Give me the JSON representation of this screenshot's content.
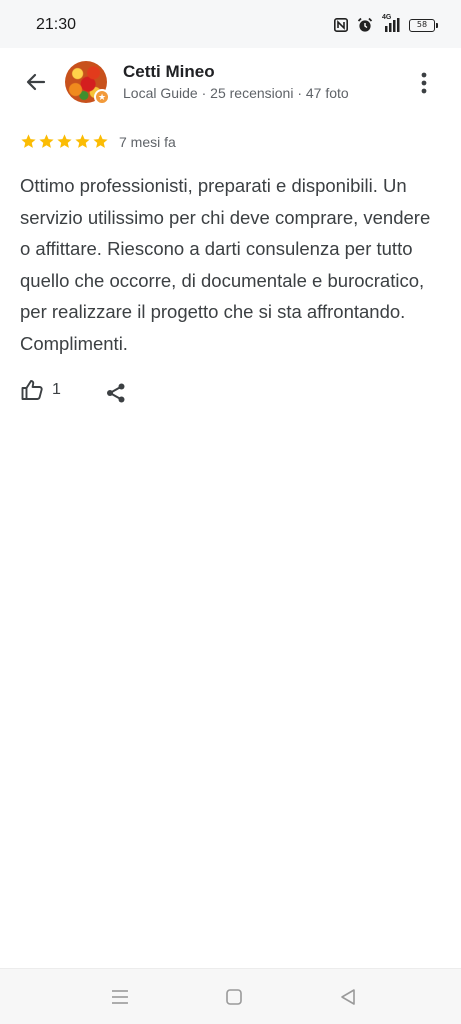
{
  "status_bar": {
    "time": "21:30",
    "network": "4G",
    "battery": "58",
    "icons": [
      "nfc-icon",
      "alarm-icon",
      "signal-icon",
      "battery-icon"
    ]
  },
  "header": {
    "back_icon": "arrow-left-icon",
    "name": "Cetti Mineo",
    "meta": "Local Guide · 25 recensioni · 47 foto",
    "more_icon": "more-vert-icon"
  },
  "review": {
    "stars": 5,
    "max_stars": 5,
    "star_color": "#fbbc04",
    "date": "7 mesi fa",
    "text": "Ottimo professionisti, preparati e disponibili. Un servizio utilissimo per chi deve comprare, vendere o affittare. Riescono a darti consulenza per tutto quello che occorre, di documentale e burocratico, per realizzare il progetto che si sta affrontando. Complimenti."
  },
  "actions": {
    "like_icon": "thumb-up-icon",
    "like_count": "1",
    "share_icon": "share-icon"
  },
  "nav": {
    "icons": [
      "menu-icon",
      "home-icon",
      "back-triangle-icon"
    ]
  }
}
